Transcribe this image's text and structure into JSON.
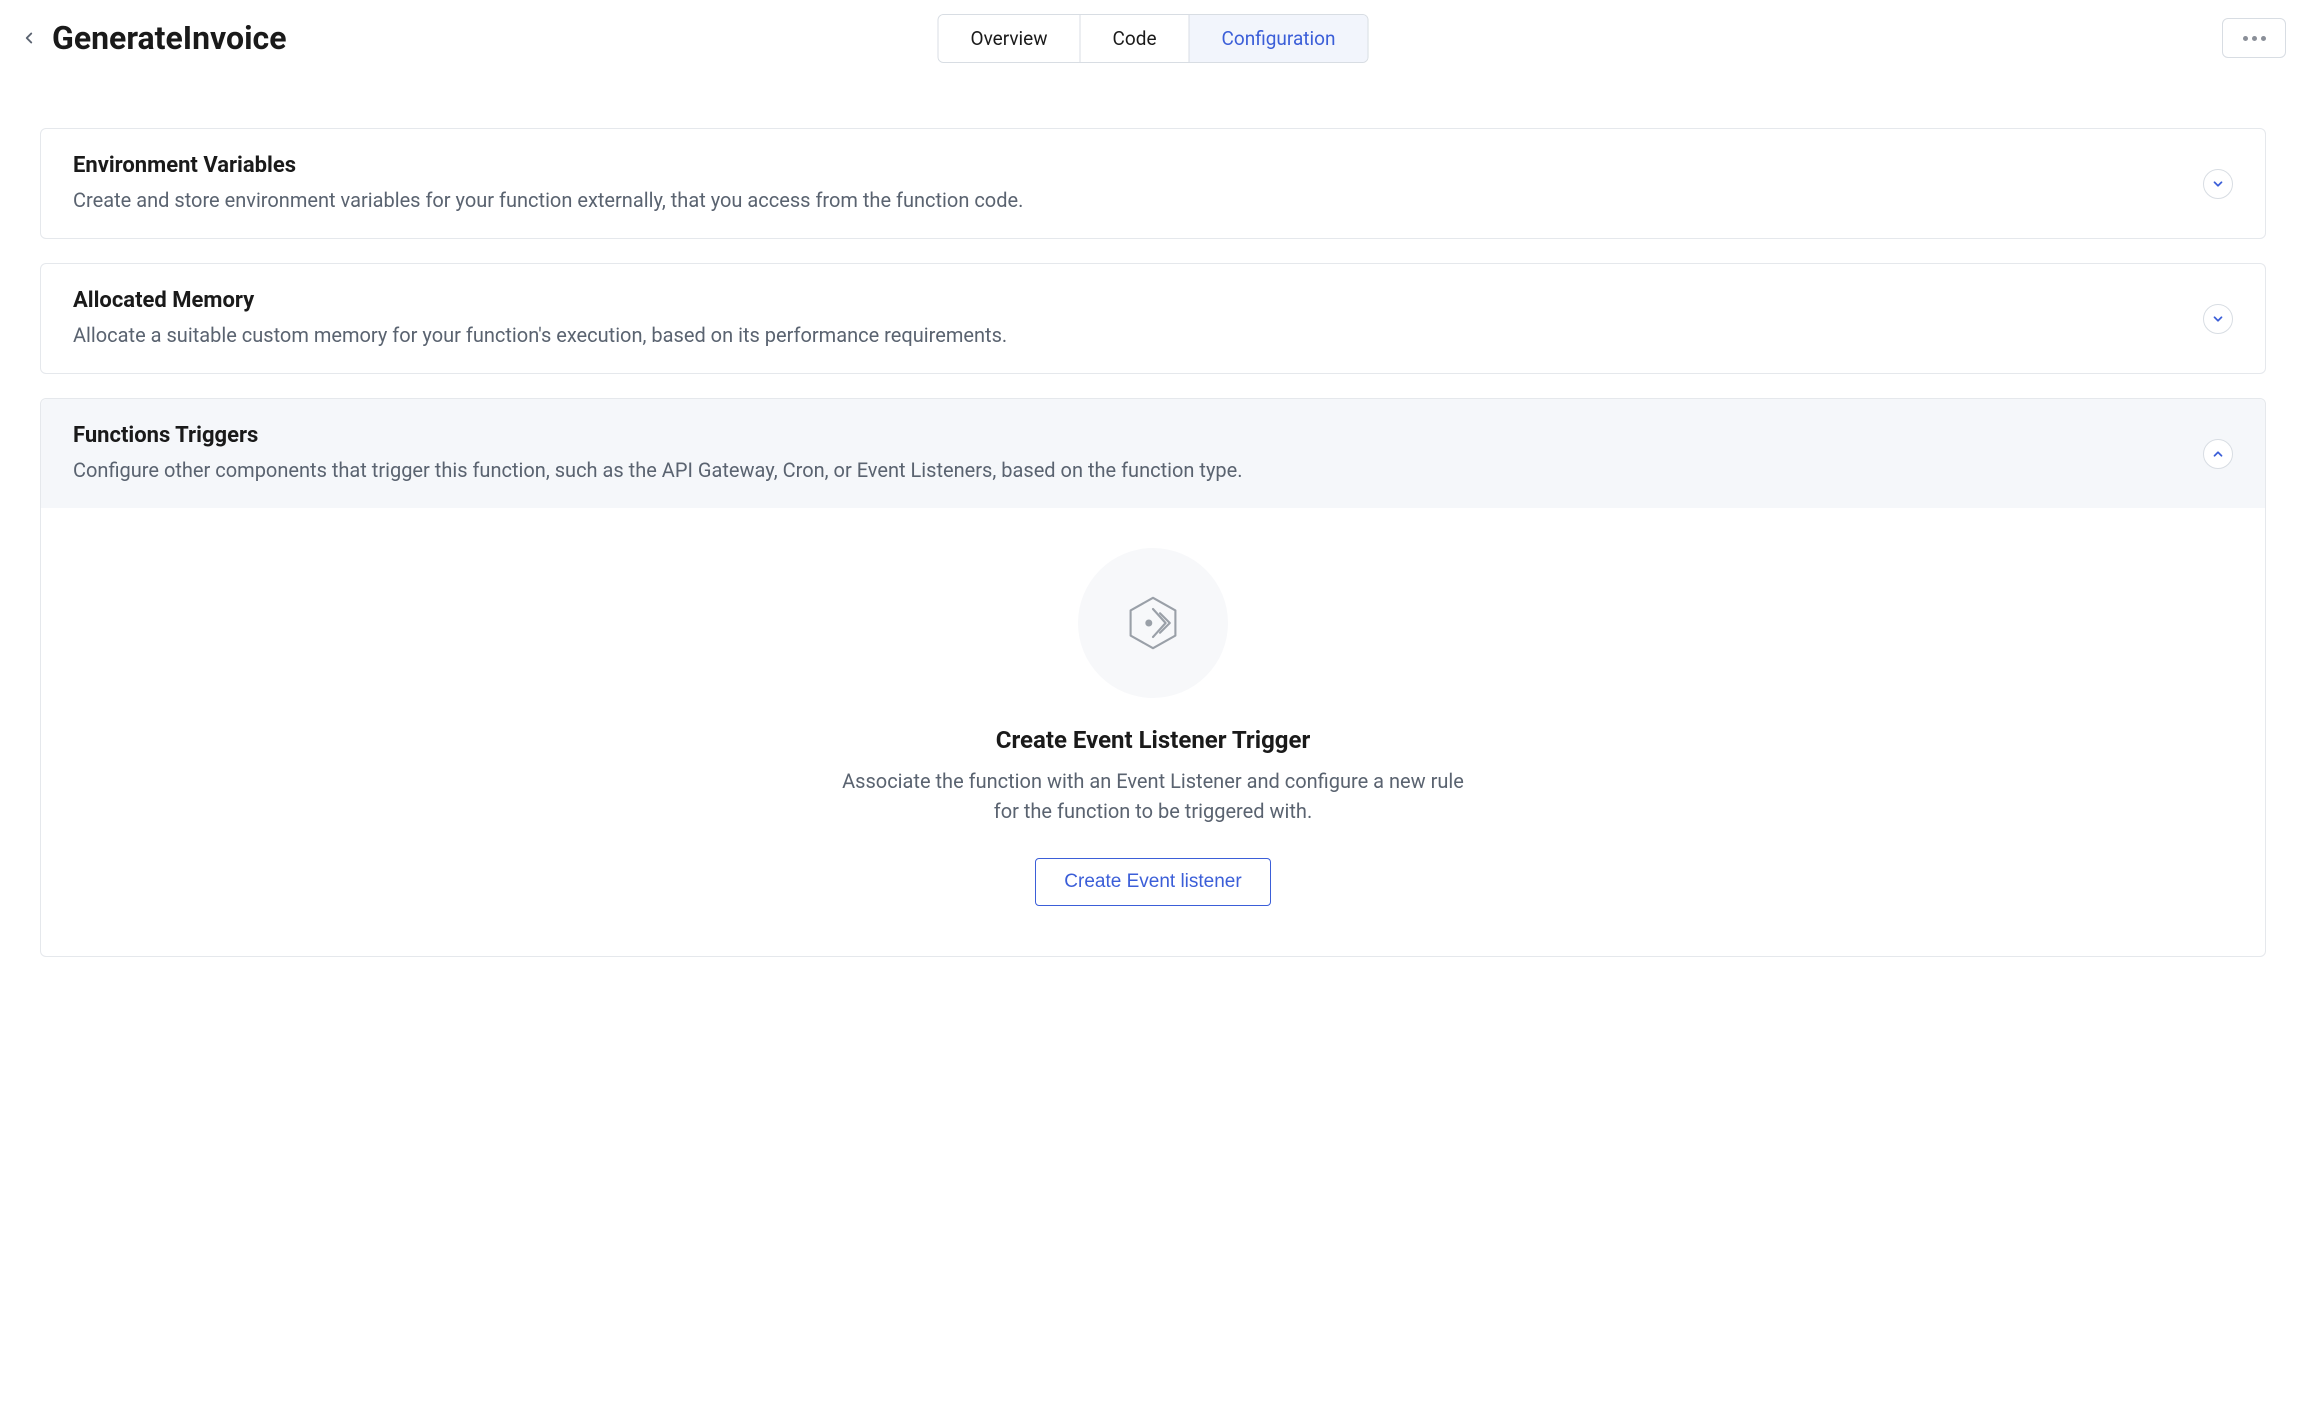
{
  "header": {
    "title": "GenerateInvoice",
    "tabs": [
      {
        "label": "Overview"
      },
      {
        "label": "Code"
      },
      {
        "label": "Configuration"
      }
    ]
  },
  "panels": {
    "env": {
      "title": "Environment Variables",
      "desc": "Create and store environment variables for your function externally, that you access from the function code."
    },
    "memory": {
      "title": "Allocated Memory",
      "desc": "Allocate a suitable custom memory for your function's execution, based on its performance requirements."
    },
    "triggers": {
      "title": "Functions Triggers",
      "desc": "Configure other components that trigger this function, such as the API Gateway, Cron, or Event Listeners, based on the function type.",
      "body_title": "Create Event Listener Trigger",
      "body_desc": "Associate the function with an Event Listener and configure a new rule for the function to be triggered with.",
      "button_label": "Create Event listener"
    }
  }
}
